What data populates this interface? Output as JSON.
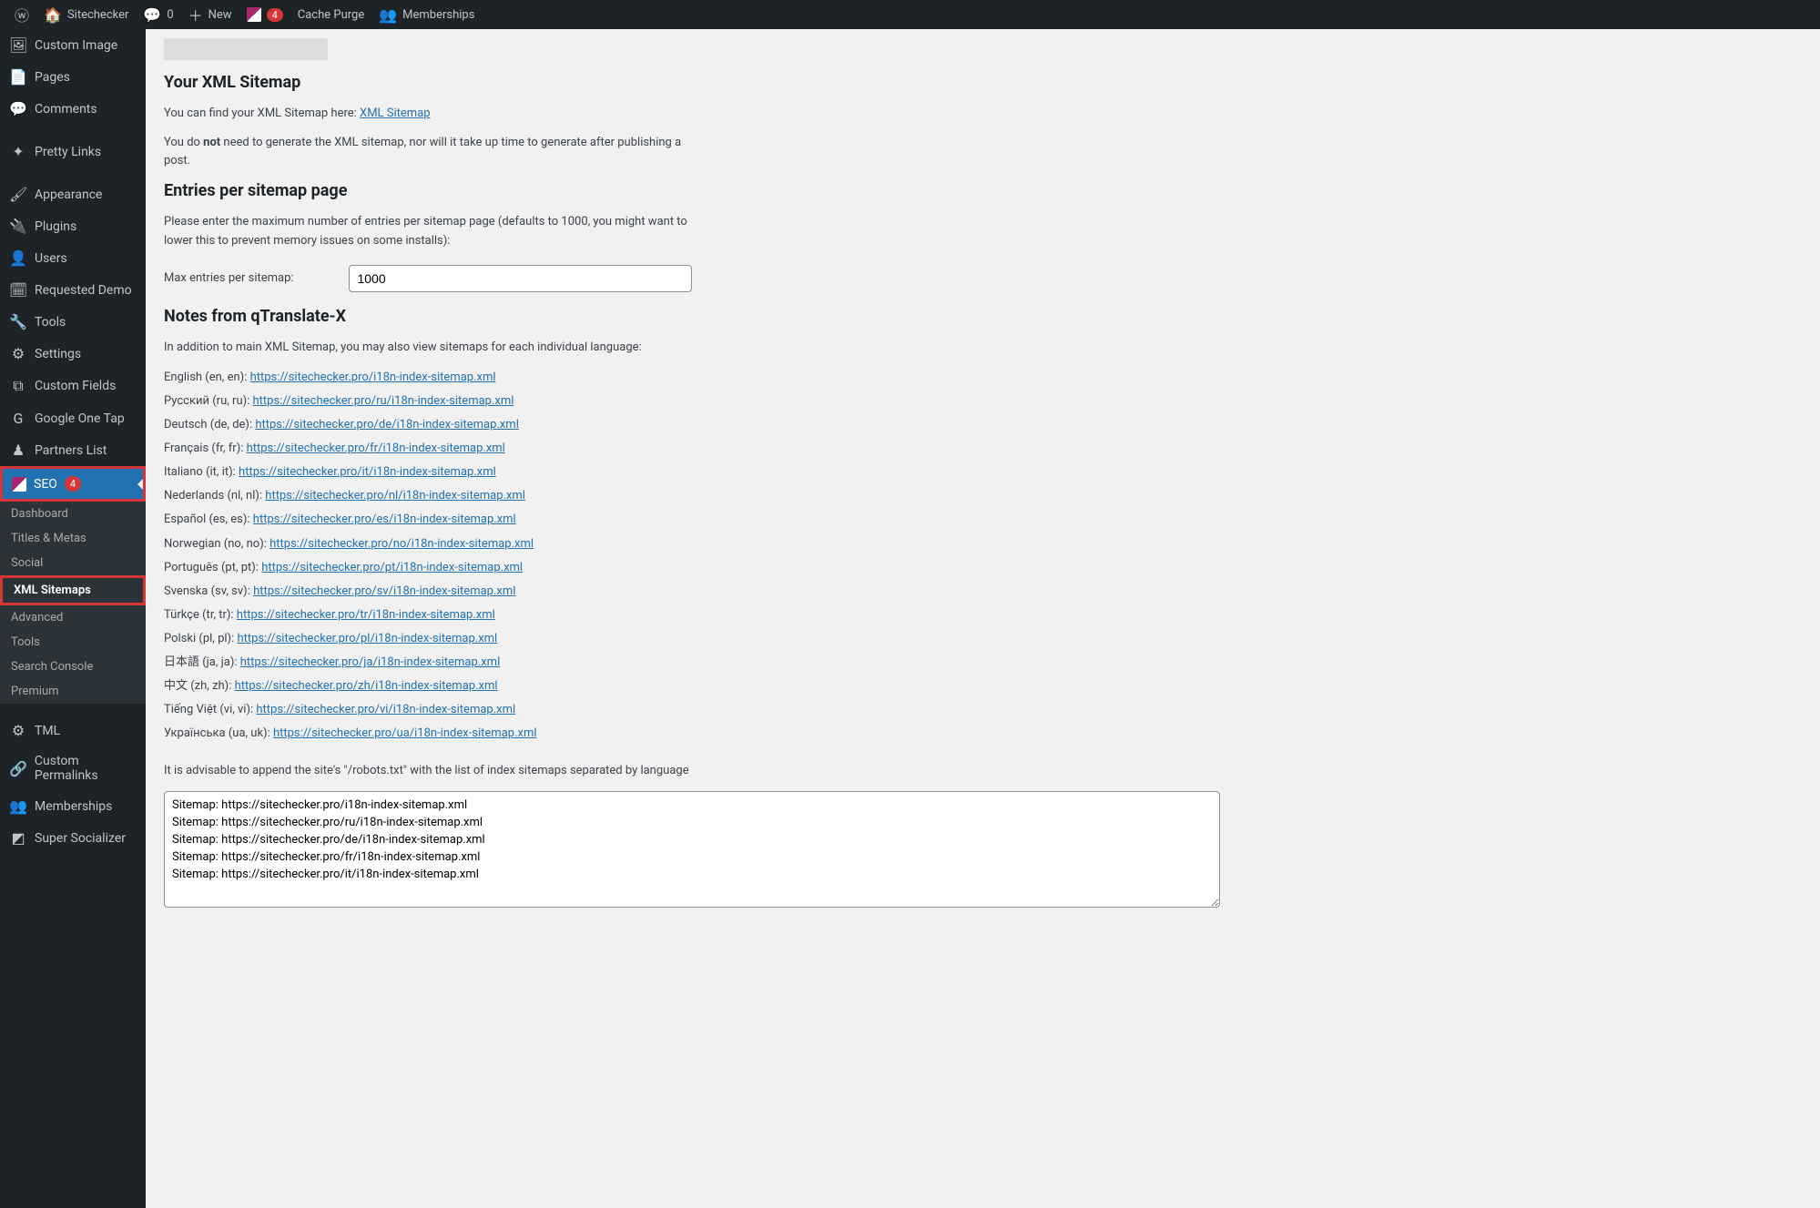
{
  "adminBar": {
    "siteName": "Sitechecker",
    "commentsCount": "0",
    "newLabel": "New",
    "yoastBadge": "4",
    "cachePurge": "Cache Purge",
    "memberships": "Memberships"
  },
  "sidebar": {
    "items": [
      {
        "icon": "🖼",
        "label": "Custom Image"
      },
      {
        "icon": "📄",
        "label": "Pages"
      },
      {
        "icon": "💬",
        "label": "Comments"
      },
      {
        "icon": "✦",
        "label": "Pretty Links"
      },
      {
        "icon": "🖌",
        "label": "Appearance"
      },
      {
        "icon": "🔌",
        "label": "Plugins"
      },
      {
        "icon": "👤",
        "label": "Users"
      },
      {
        "icon": "🗓",
        "label": "Requested Demo"
      },
      {
        "icon": "🔧",
        "label": "Tools"
      },
      {
        "icon": "⚙",
        "label": "Settings"
      },
      {
        "icon": "⧉",
        "label": "Custom Fields"
      },
      {
        "icon": "G",
        "label": "Google One Tap"
      },
      {
        "icon": "♟",
        "label": "Partners List"
      }
    ],
    "seo": {
      "label": "SEO",
      "badge": "4"
    },
    "seoSub": [
      {
        "label": "Dashboard"
      },
      {
        "label": "Titles & Metas"
      },
      {
        "label": "Social"
      },
      {
        "label": "XML Sitemaps",
        "current": true
      },
      {
        "label": "Advanced"
      },
      {
        "label": "Tools"
      },
      {
        "label": "Search Console"
      },
      {
        "label": "Premium"
      }
    ],
    "itemsAfter": [
      {
        "icon": "⚙",
        "label": "TML"
      },
      {
        "icon": "🔗",
        "label": "Custom Permalinks"
      },
      {
        "icon": "👥",
        "label": "Memberships"
      },
      {
        "icon": "◩",
        "label": "Super Socializer"
      }
    ]
  },
  "main": {
    "h_xml": "Your XML Sitemap",
    "p_find_prefix": "You can find your XML Sitemap here: ",
    "link_xml": "XML Sitemap",
    "p_not1": "You do ",
    "p_not_bold": "not",
    "p_not2": " need to generate the XML sitemap, nor will it take up time to generate after publishing a post.",
    "h_entries": "Entries per sitemap page",
    "p_entries": "Please enter the maximum number of entries per sitemap page (defaults to 1000, you might want to lower this to prevent memory issues on some installs):",
    "label_max": "Max entries per sitemap:",
    "value_max": "1000",
    "h_notes": "Notes from qTranslate-X",
    "p_notes": "In addition to main XML Sitemap, you may also view sitemaps for each individual language:",
    "languages": [
      {
        "label": "English (en, en): ",
        "url": "https://sitechecker.pro/i18n-index-sitemap.xml"
      },
      {
        "label": "Русский (ru, ru): ",
        "url": "https://sitechecker.pro/ru/i18n-index-sitemap.xml"
      },
      {
        "label": "Deutsch (de, de): ",
        "url": "https://sitechecker.pro/de/i18n-index-sitemap.xml"
      },
      {
        "label": "Français (fr, fr): ",
        "url": "https://sitechecker.pro/fr/i18n-index-sitemap.xml"
      },
      {
        "label": "Italiano (it, it): ",
        "url": "https://sitechecker.pro/it/i18n-index-sitemap.xml"
      },
      {
        "label": "Nederlands (nl, nl): ",
        "url": "https://sitechecker.pro/nl/i18n-index-sitemap.xml"
      },
      {
        "label": "Español (es, es): ",
        "url": "https://sitechecker.pro/es/i18n-index-sitemap.xml"
      },
      {
        "label": "Norwegian (no, no): ",
        "url": "https://sitechecker.pro/no/i18n-index-sitemap.xml"
      },
      {
        "label": "Português (pt, pt): ",
        "url": "https://sitechecker.pro/pt/i18n-index-sitemap.xml"
      },
      {
        "label": "Svenska (sv, sv): ",
        "url": "https://sitechecker.pro/sv/i18n-index-sitemap.xml"
      },
      {
        "label": "Türkçe (tr, tr): ",
        "url": "https://sitechecker.pro/tr/i18n-index-sitemap.xml"
      },
      {
        "label": "Polski (pl, pl): ",
        "url": "https://sitechecker.pro/pl/i18n-index-sitemap.xml"
      },
      {
        "label": "日本語 (ja, ja): ",
        "url": "https://sitechecker.pro/ja/i18n-index-sitemap.xml"
      },
      {
        "label": "中文 (zh, zh): ",
        "url": "https://sitechecker.pro/zh/i18n-index-sitemap.xml"
      },
      {
        "label": "Tiếng Việt (vi, vi): ",
        "url": "https://sitechecker.pro/vi/i18n-index-sitemap.xml"
      },
      {
        "label": "Українська (ua, uk): ",
        "url": "https://sitechecker.pro/ua/i18n-index-sitemap.xml"
      }
    ],
    "p_robots": "It is advisable to append the site's \"/robots.txt\" with the list of index sitemaps separated by language",
    "robots_text": "Sitemap: https://sitechecker.pro/i18n-index-sitemap.xml\nSitemap: https://sitechecker.pro/ru/i18n-index-sitemap.xml\nSitemap: https://sitechecker.pro/de/i18n-index-sitemap.xml\nSitemap: https://sitechecker.pro/fr/i18n-index-sitemap.xml\nSitemap: https://sitechecker.pro/it/i18n-index-sitemap.xml"
  }
}
